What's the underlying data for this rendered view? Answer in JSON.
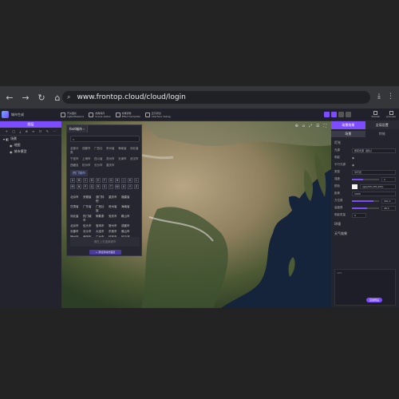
{
  "browser": {
    "url": "www.frontop.cloud/cloud/login",
    "nav": [
      "←",
      "→",
      "↻",
      "⌂"
    ]
  },
  "app": {
    "brand": "城市生成",
    "tools": [
      {
        "l1": "开关图标",
        "l2": "Light/Measure"
      },
      {
        "l1": "视角保存",
        "l2": "Scene status"
      },
      {
        "l1": "效果调整",
        "l2": "Effect template"
      },
      {
        "l1": "显示调试",
        "l2": "Interface debug"
      }
    ],
    "right_tools": [
      {
        "l1": "发布",
        "l2": "Publish"
      },
      {
        "l1": "预览",
        "l2": "preview"
      }
    ]
  },
  "left_panel": {
    "header": "图层",
    "tools": [
      "+",
      "□",
      "⤓",
      "⊕",
      "≡",
      "☷",
      "✎",
      "⋯"
    ],
    "tree": [
      {
        "label": "场景",
        "level": 1
      },
      {
        "label": "地图",
        "level": 2
      },
      {
        "label": "城市模型",
        "level": 2
      }
    ]
  },
  "font_panel": {
    "tab": "font城市 ‹",
    "search_placeholder": "",
    "categories": [
      "全部分类",
      "成都市",
      "广西壮",
      "贵州省",
      "海南省",
      "河北省",
      "宁波市",
      "上海市",
      "四川省",
      "苏州市",
      "天津市",
      "武汉市",
      "西藏自",
      "杭州市",
      "长沙市",
      "重庆市"
    ],
    "common_tab": "热门城市",
    "letters": [
      "A",
      "B",
      "C",
      "D",
      "E",
      "F",
      "G",
      "H",
      "J",
      "K",
      "L",
      "M",
      "N",
      "P",
      "Q",
      "R",
      "S",
      "T",
      "W",
      "X",
      "Y",
      "Z"
    ],
    "fonts": [
      "北京市",
      "安徽省",
      "澳门特别",
      "重庆市",
      "福建省",
      "甘肃省",
      "广东省",
      "广西壮族",
      "贵州省",
      "海南省",
      "河北省",
      "热门城市",
      "阿勒泰",
      "安庆市",
      "鞍山市",
      "北京市",
      "包头市",
      "宝鸡市",
      "常州市",
      "成都市",
      "长春市",
      "长沙市",
      "大连市",
      "东莞市",
      "佛山市",
      "福州市",
      "贵阳市",
      "广州市",
      "桂林市",
      "哈尔滨",
      "杭州市"
    ],
    "hint": "请在上方选择城市",
    "button": "+ 添加到城市图层"
  },
  "map": {
    "tools": [
      "⊕",
      "⌂",
      "⤢",
      "☰",
      "⛶"
    ]
  },
  "right_panel": {
    "tabs": [
      "场景效果",
      "全局设置"
    ],
    "subtabs": [
      "场景",
      "特效"
    ],
    "section": "灯光",
    "rows": [
      {
        "label": "光源",
        "value": "所有光源（默认）"
      },
      {
        "label": "阴影",
        "value": ""
      },
      {
        "label": "平行光源",
        "value": ""
      },
      {
        "label": "类型",
        "value": "平行光"
      },
      {
        "label": "强度",
        "value": "2"
      },
      {
        "label": "颜色",
        "value": "rgb(255,255,255)"
      },
      {
        "label": "距离",
        "value": "1000"
      },
      {
        "label": "方位角",
        "value": "301.3"
      },
      {
        "label": "高度角",
        "value": "48.2"
      },
      {
        "label": "阴影质量",
        "value": "0"
      }
    ],
    "more_section": "环境",
    "more_section2": "天气效果",
    "box_label": "10%",
    "preview_button": "应用预设"
  }
}
